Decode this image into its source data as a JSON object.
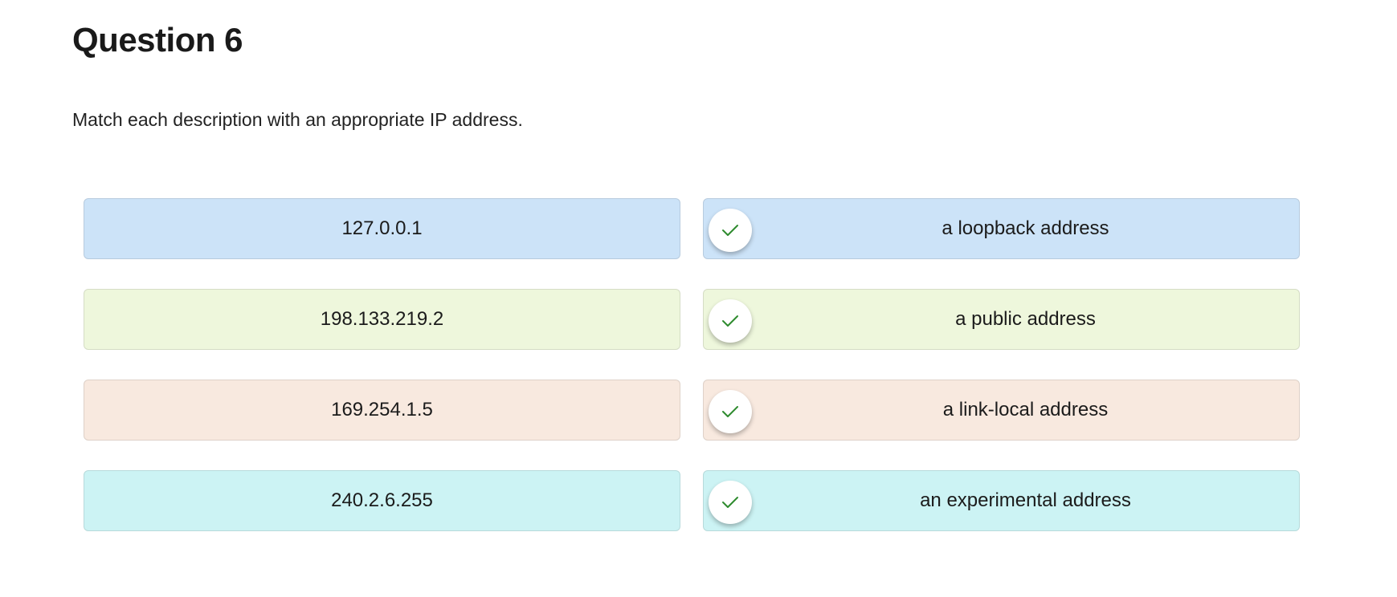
{
  "question": {
    "title": "Question 6",
    "prompt": "Match each description with an appropriate IP address."
  },
  "pairs": [
    {
      "address": "127.0.0.1",
      "description": "a loopback address",
      "color": "#cce3f8",
      "matched": true
    },
    {
      "address": "198.133.219.2",
      "description": "a public address",
      "color": "#eef7dc",
      "matched": true
    },
    {
      "address": "169.254.1.5",
      "description": "a link-local address",
      "color": "#f8e9df",
      "matched": true
    },
    {
      "address": "240.2.6.255",
      "description": "an experimental address",
      "color": "#ccf3f4",
      "matched": true
    }
  ],
  "icons": {
    "check": "check-icon",
    "check_color": "#2e8b2e"
  }
}
